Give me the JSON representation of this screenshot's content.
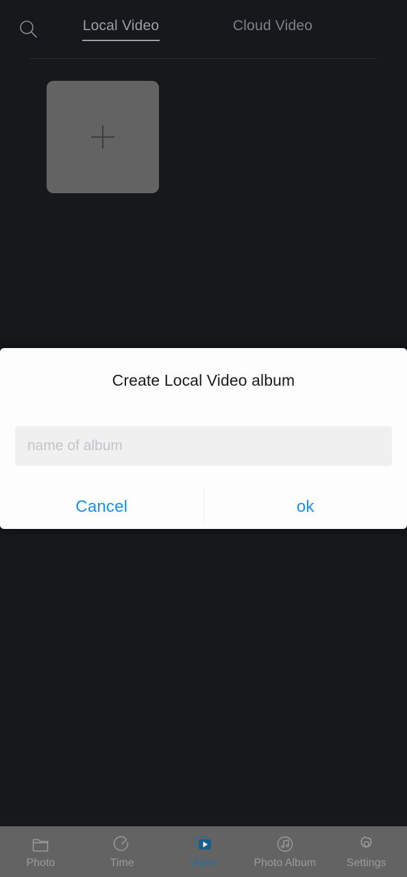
{
  "colors": {
    "app_background": "#16181c",
    "tile": "#636363",
    "dialog_background": "#fdfdfd",
    "dialog_action_blue": "#1e8fe8",
    "nav_background": "#636363",
    "nav_active_blue": "#2e6e95",
    "nav_inactive_label": "#9c9c9c",
    "tab_active_text": "#9aa0a7",
    "tab_inactive_text": "#7d838a"
  },
  "topbar": {
    "search_icon": "search-icon",
    "tabs": [
      {
        "label": "Local Video",
        "active": true
      },
      {
        "label": "Cloud Video",
        "active": false
      }
    ]
  },
  "content": {
    "add_album_tile": {
      "icon": "plus-icon",
      "label": ""
    }
  },
  "dialog": {
    "title": "Create Local Video album",
    "input": {
      "value": "",
      "placeholder": "name of album"
    },
    "cancel_label": "Cancel",
    "ok_label": "ok"
  },
  "bottom_nav": {
    "items": [
      {
        "label": "Photo",
        "icon": "folder-icon",
        "active": false
      },
      {
        "label": "Time",
        "icon": "timer-icon",
        "active": false
      },
      {
        "label": "Video",
        "icon": "video-icon",
        "active": true
      },
      {
        "label": "Photo Album",
        "icon": "music-note-circle-icon",
        "active": false
      },
      {
        "label": "Settings",
        "icon": "gear-icon",
        "active": false
      }
    ]
  }
}
